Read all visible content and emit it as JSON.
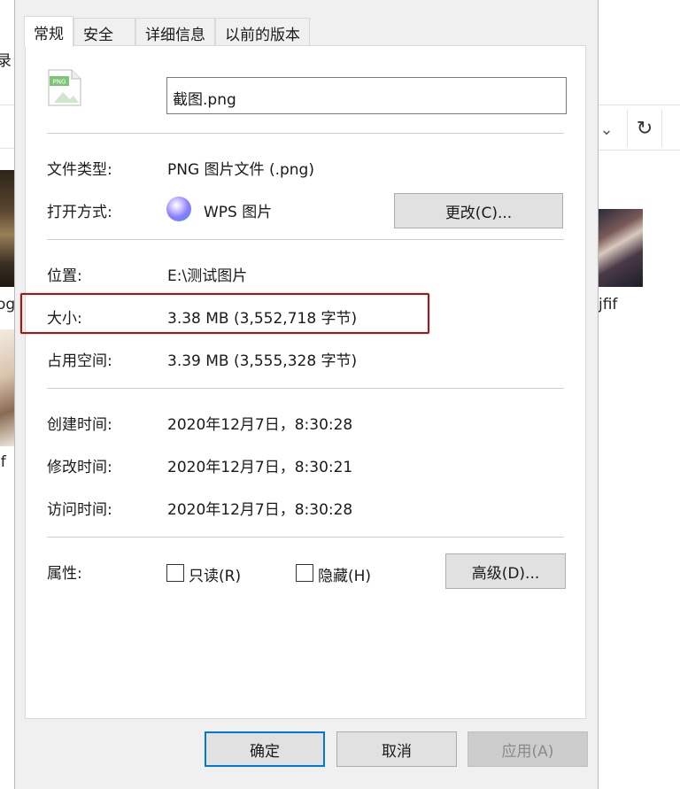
{
  "background": {
    "left_labels": [
      "录",
      "og",
      "jf"
    ],
    "right_label": "jfif",
    "chevron": "⌄",
    "refresh": "↻"
  },
  "dialog": {
    "tabs": [
      "常规",
      "安全",
      "详细信息",
      "以前的版本"
    ],
    "active_tab": "常规",
    "file_icon_label": "PNG",
    "file_name": "截图.png",
    "fields": {
      "type_label": "文件类型:",
      "type_value": "PNG 图片文件 (.png)",
      "open_with_label": "打开方式:",
      "open_with_value": "WPS 图片",
      "change_button": "更改(C)...",
      "location_label": "位置:",
      "location_value": "E:\\测试图片",
      "size_label": "大小:",
      "size_value": "3.38 MB (3,552,718 字节)",
      "size_on_disk_label": "占用空间:",
      "size_on_disk_value": "3.39 MB (3,555,328 字节)",
      "created_label": "创建时间:",
      "created_value": "2020年12月7日，8:30:28",
      "modified_label": "修改时间:",
      "modified_value": "2020年12月7日，8:30:21",
      "accessed_label": "访问时间:",
      "accessed_value": "2020年12月7日，8:30:28",
      "attributes_label": "属性:",
      "readonly_label": "只读(R)",
      "hidden_label": "隐藏(H)",
      "advanced_button": "高级(D)..."
    },
    "buttons": {
      "ok": "确定",
      "cancel": "取消",
      "apply": "应用(A)"
    }
  },
  "colors": {
    "highlight": "#a01818",
    "focus_blue": "#0078d7"
  }
}
